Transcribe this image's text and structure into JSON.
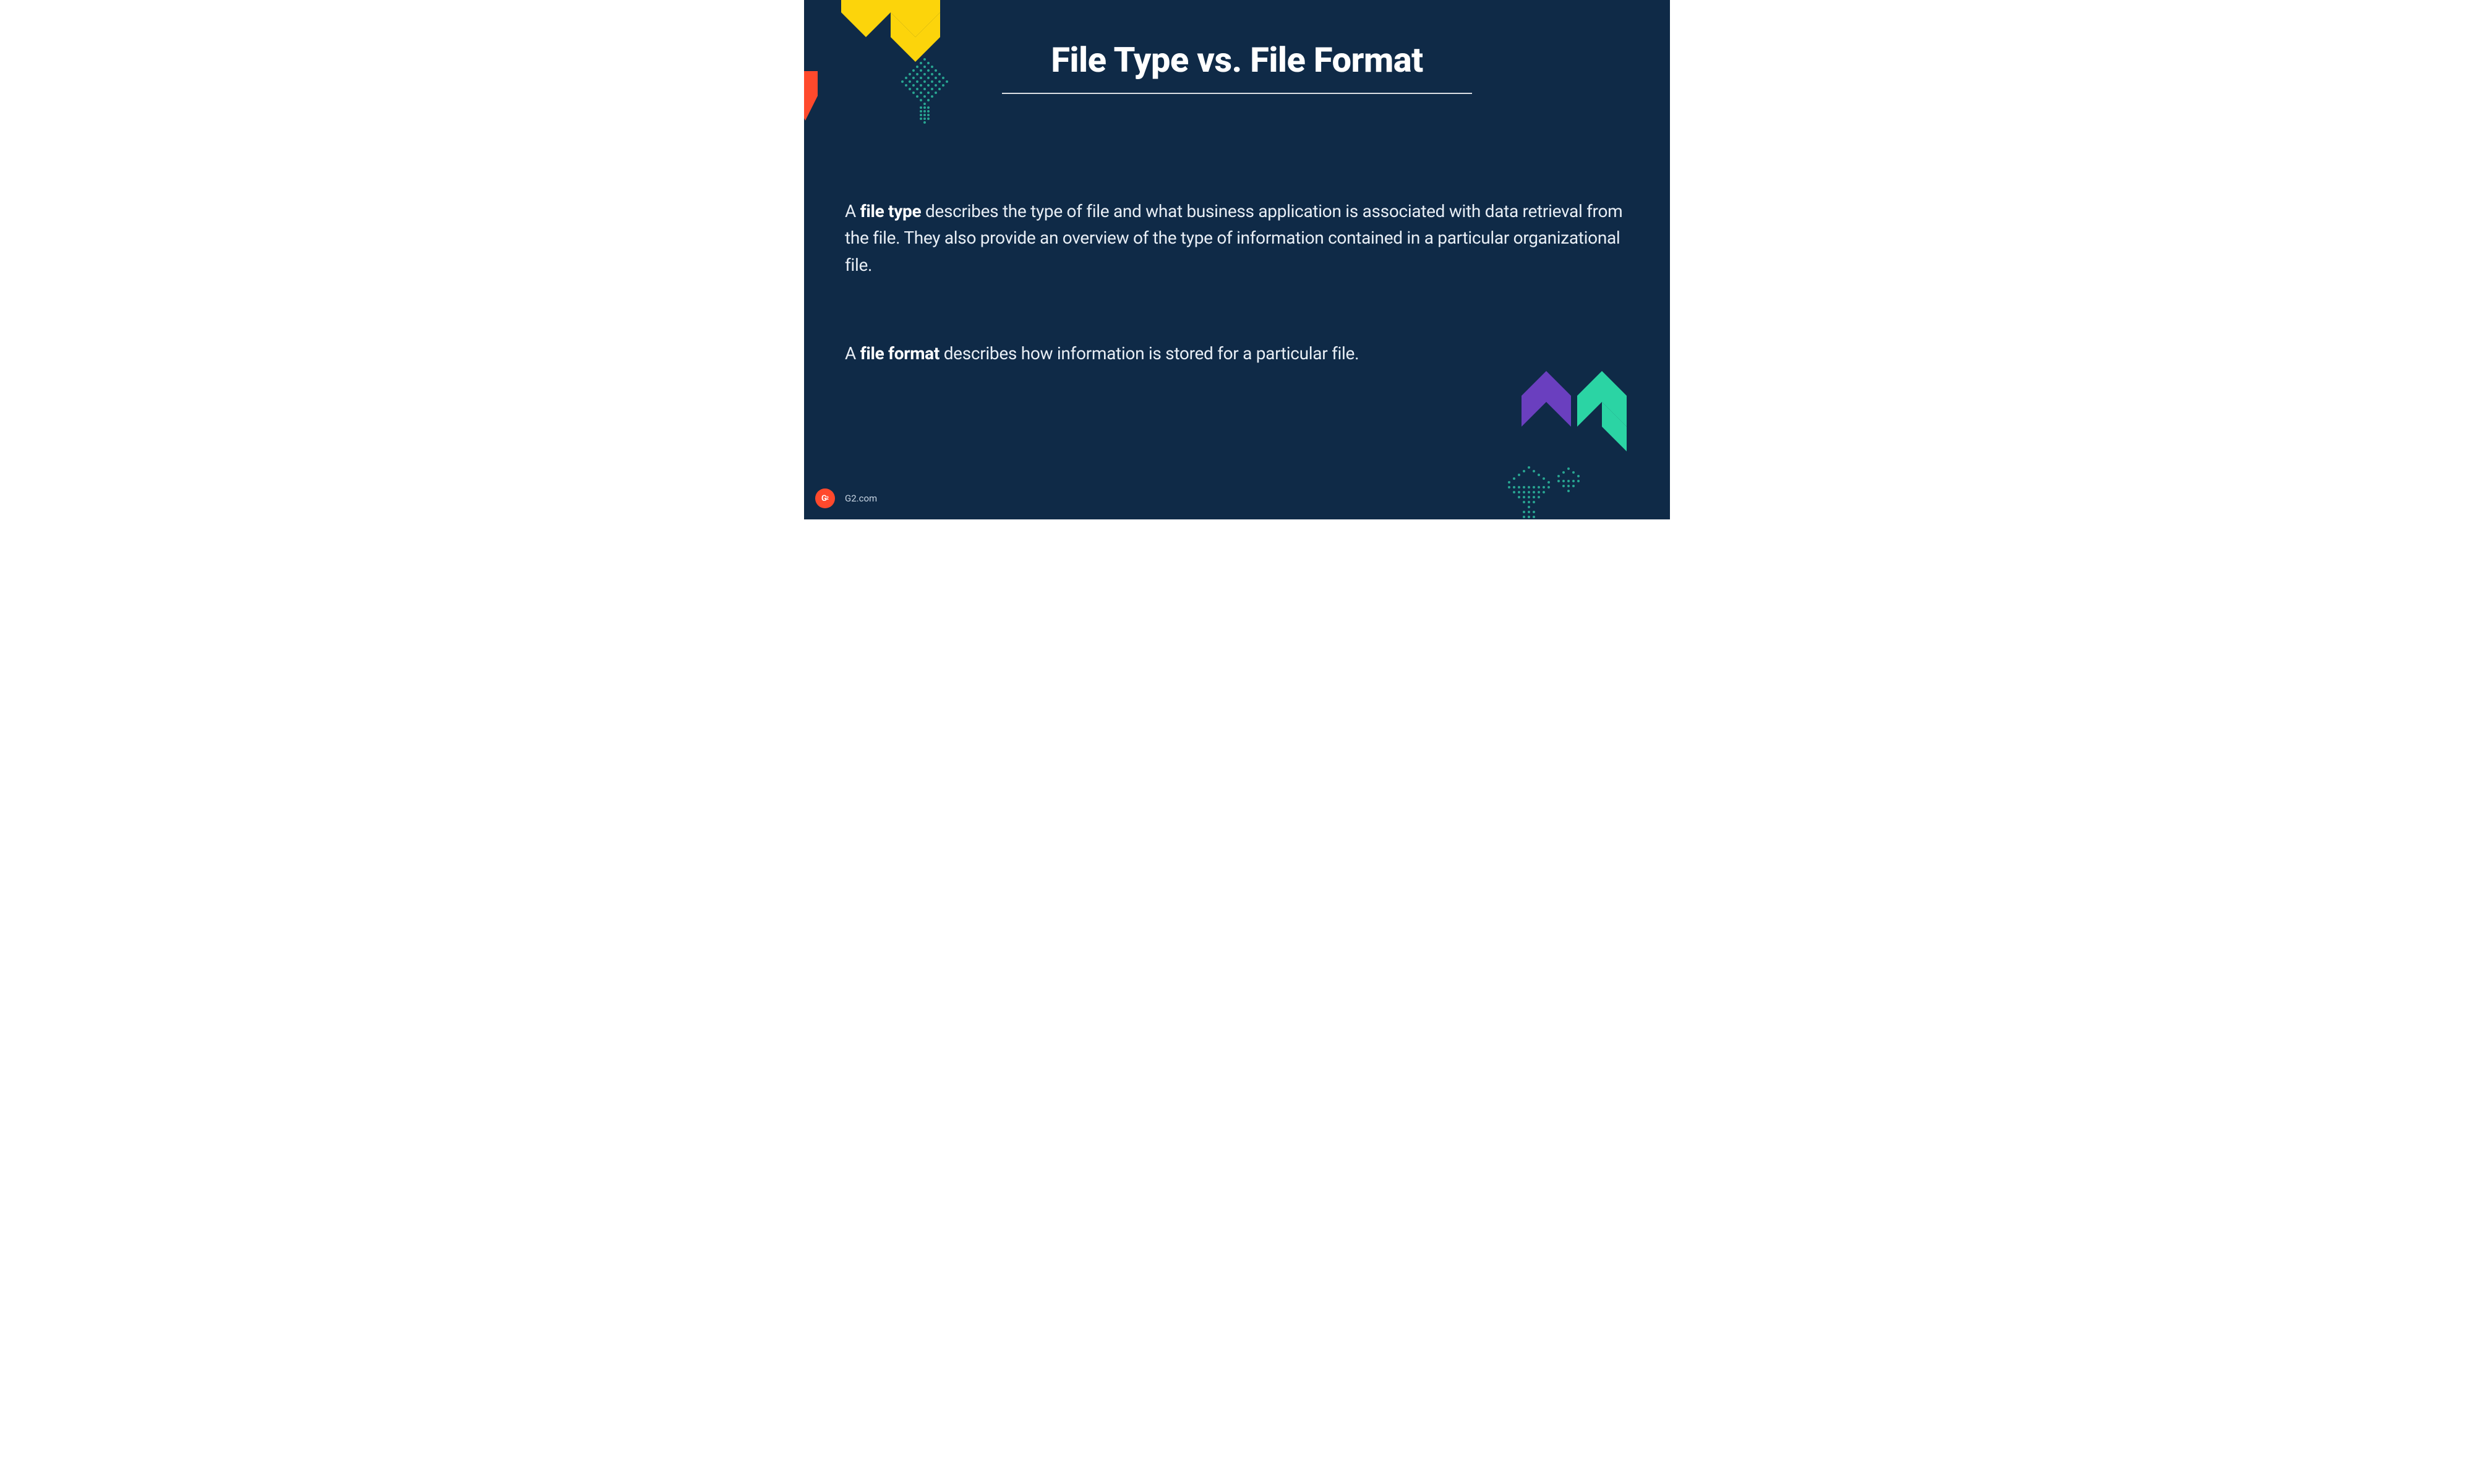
{
  "title": "File Type vs. File Format",
  "paragraphs": {
    "p1_a": "A ",
    "p1_bold": "file type",
    "p1_b": " describes the type of file and what business application is associated with data retrieval from the  file. They also provide an overview of the type of information contained in a particular organizational file.",
    "p2_a": "A ",
    "p2_bold": "file format",
    "p2_b": " describes how information is stored for a particular file."
  },
  "footer": {
    "logo_text_g": "G",
    "logo_text_2": "2",
    "site": "G2.com"
  },
  "colors": {
    "bg": "#0f2a47",
    "yellow": "#fcd40b",
    "red": "#ff492c",
    "teal": "#2bd4a4",
    "purple": "#6a3fbf",
    "dotTeal": "#2bb39a"
  }
}
